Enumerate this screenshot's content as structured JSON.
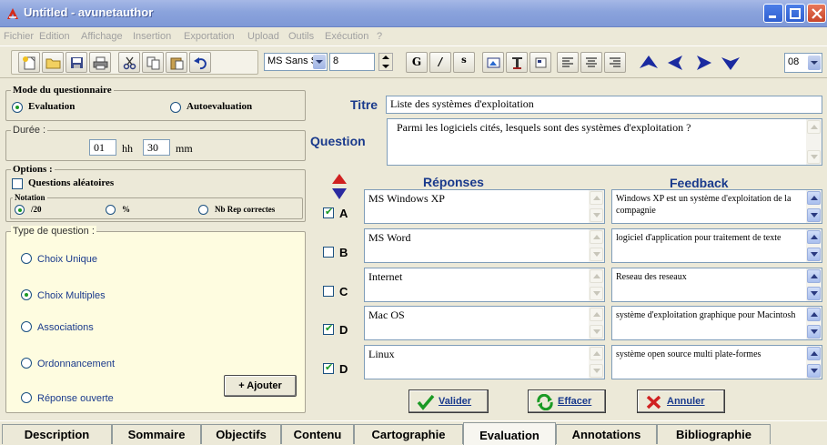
{
  "window": {
    "title": "Untitled - avunetauthor"
  },
  "menu": [
    "Fichier",
    "Edition",
    "Affichage",
    "Insertion",
    "Exportation",
    "Upload",
    "Outils",
    "Exécution",
    "?"
  ],
  "toolbar": {
    "font_name": "MS Sans Se",
    "font_size": "8",
    "zoom": "08",
    "format_glyphs": {
      "bold": "G",
      "italic": "/",
      "strike": "s"
    }
  },
  "mode": {
    "legend": "Mode du questionnaire",
    "options": [
      {
        "label": "Evaluation",
        "selected": true
      },
      {
        "label": "Autoevaluation",
        "selected": false
      }
    ]
  },
  "duree": {
    "legend": "Durée :",
    "hours": "01",
    "hours_unit": "hh",
    "minutes": "30",
    "minutes_unit": "mm"
  },
  "options": {
    "legend": "Options :",
    "random_label": "Questions aléatoires",
    "random_checked": false,
    "notation_legend": "Notation",
    "notation": [
      {
        "label": "/20",
        "selected": true
      },
      {
        "label": "%",
        "selected": false
      },
      {
        "label": "Nb Rep correctes",
        "selected": false
      }
    ]
  },
  "question_type": {
    "legend": "Type de question :",
    "options": [
      {
        "label": "Choix Unique",
        "selected": false
      },
      {
        "label": "Choix Multiples",
        "selected": true
      },
      {
        "label": "Associations",
        "selected": false
      },
      {
        "label": "Ordonnancement",
        "selected": false
      },
      {
        "label": "Réponse ouverte",
        "selected": false
      }
    ],
    "add_button": "+  Ajouter"
  },
  "form": {
    "title_label": "Titre",
    "title_value": "Liste des systèmes d'exploitation",
    "question_label": "Question",
    "question_value": "Parmi les logiciels cités, lesquels sont des systèmes d'exploitation ?"
  },
  "answers": {
    "col_reponses": "Réponses",
    "col_feedback": "Feedback",
    "rows": [
      {
        "letter": "A",
        "checked": true,
        "answer": "MS Windows XP",
        "feedback": "Windows XP est un système d'exploitation de la compagnie"
      },
      {
        "letter": "B",
        "checked": false,
        "answer": "MS Word",
        "feedback": "logiciel d'application pour traitement de texte"
      },
      {
        "letter": "C",
        "checked": false,
        "answer": "Internet",
        "feedback": "Reseau des reseaux"
      },
      {
        "letter": "D",
        "checked": true,
        "answer": "Mac OS",
        "feedback": "système d'exploitation graphique pour Macintosh"
      },
      {
        "letter": "D",
        "checked": true,
        "answer": "Linux",
        "feedback": "système open source multi plate-formes"
      }
    ]
  },
  "actions": {
    "validate": "Valider",
    "clear": "Effacer",
    "cancel": "Annuler"
  },
  "tabs": [
    {
      "label": "Description",
      "active": false
    },
    {
      "label": "Sommaire",
      "active": false
    },
    {
      "label": "Objectifs",
      "active": false
    },
    {
      "label": "Contenu",
      "active": false
    },
    {
      "label": "Cartographie",
      "active": false
    },
    {
      "label": "Evaluation",
      "active": true
    },
    {
      "label": "Annotations",
      "active": false
    },
    {
      "label": "Bibliographie",
      "active": false
    }
  ],
  "colors": {
    "label_blue": "#1a3a8c",
    "check_green": "#1a9a24",
    "panel_bg": "#ece9d8",
    "yellow_panel": "#fefce0"
  }
}
